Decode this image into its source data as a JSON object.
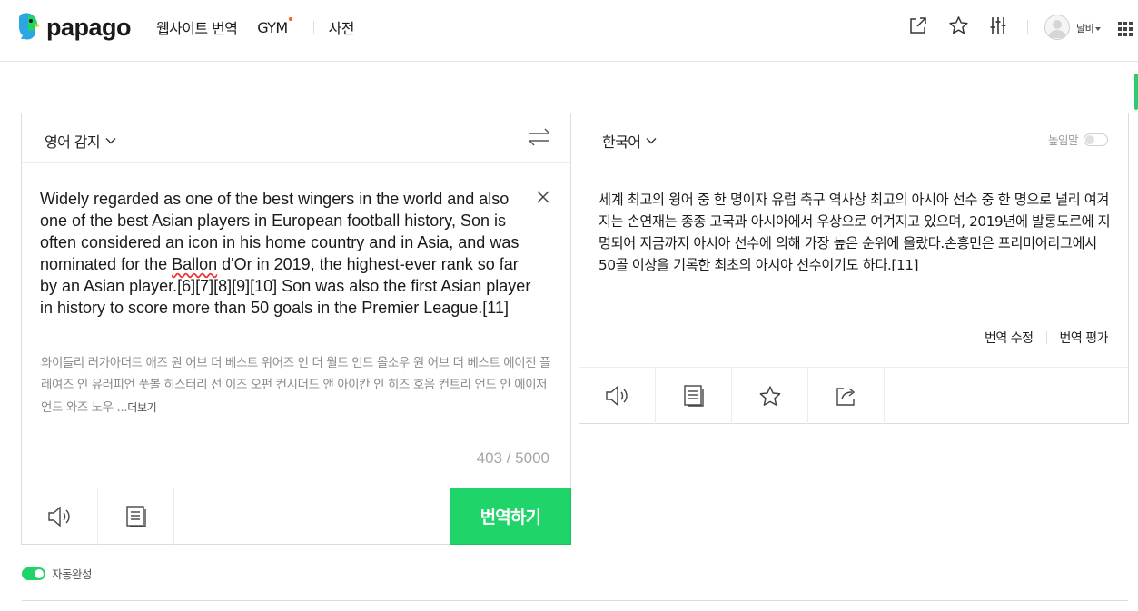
{
  "brand": {
    "logo_text": "papago",
    "accent_color": "#1fd469"
  },
  "nav": {
    "website_translate": "웹사이트 번역",
    "gym": "GYM",
    "dictionary": "사전"
  },
  "header": {
    "user_name": "날비",
    "icons": [
      "share-window-icon",
      "star-icon",
      "settings-sliders-icon",
      "avatar",
      "apps-grid-icon"
    ]
  },
  "source": {
    "language": "영어 감지",
    "text_before_underline": "Widely regarded as one of the best wingers in the world and also one of the best Asian players in European football history, Son is often considered an icon in his home country and in Asia, and was nominated for the ",
    "text_underlined": "Ballon",
    "text_after_underline": " d'Or in 2019, the highest-ever rank so far by an Asian player.[6][7][8][9][10] Son was also the first Asian player in history to score more than 50 goals in the Premier League.[11]",
    "pronunciation": "와이들리 러가아더드 애즈 원 어브 더 베스트 위어즈 인 더 월드 언드 올소우 원 어브 더 베스트 에이전 플레여즈 인 유러피언 풋볼 히스터리 선 이즈 오펀 컨시더드 앤 아이칸 인 히즈 호음 컨트리 언드 인 에이저 언드 와즈 노우 ...",
    "more_label": "더보기",
    "char_count": "403 / 5000",
    "translate_button": "번역하기"
  },
  "target": {
    "language": "한국어",
    "honorific_label": "높임말",
    "honorific_on": false,
    "text": "세계 최고의 윙어 중 한 명이자 유럽 축구 역사상 최고의 아시아 선수 중 한 명으로 널리 여겨지는 손연재는 종종 고국과 아시아에서 우상으로 여겨지고 있으며, 2019년에 발롱도르에 지명되어 지금까지 아시아 선수에 의해 가장 높은 순위에 올랐다.손흥민은 프리미어리그에서 50골 이상을 기록한 최초의 아시아 선수이기도 하다.[11]",
    "edit_label": "번역 수정",
    "rate_label": "번역 평가"
  },
  "autocomplete": {
    "label": "자동완성",
    "on": true
  }
}
